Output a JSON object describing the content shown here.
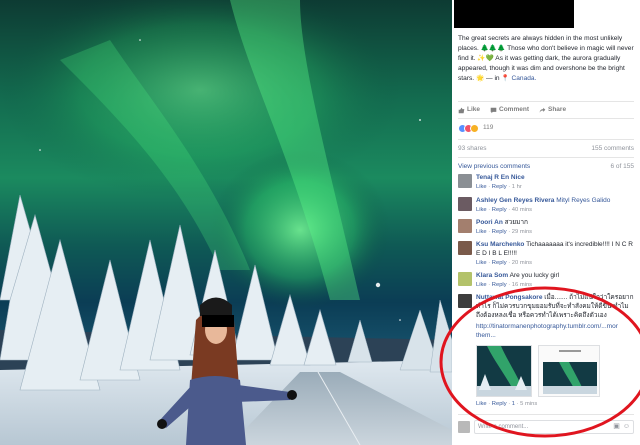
{
  "post": {
    "caption": "The great secrets are always hidden in the most unlikely places. 🌲🌲🌲 Those who don't believe in magic will never find it. ✨💚 As it was getting dark, the aurora gradually appeared, though it was dim and overshone be the bright stars. 🌟",
    "location_prefix": "— in 📍",
    "location": "Canada."
  },
  "actions": {
    "like": "Like",
    "comment": "Comment",
    "share": "Share"
  },
  "reactions": {
    "count": "119"
  },
  "stats": {
    "shares": "93 shares",
    "comments": "155 comments"
  },
  "comments_header": {
    "view_previous": "View previous comments",
    "count": "6 of 155"
  },
  "comments": [
    {
      "name": "Tenaj R En Nice",
      "text": "",
      "meta_like": "Like",
      "meta_reply": "Reply",
      "meta_time": "1 hr",
      "avatar_color": "#8a8f94"
    },
    {
      "name": "Ashley Gen Reyes Rivera",
      "text": "Mityl Reyes Galido",
      "meta_like": "Like",
      "meta_reply": "Reply",
      "meta_time": "40 mins",
      "avatar_color": "#6b5b62"
    },
    {
      "name": "Poori An",
      "text": "สวยมาก",
      "meta_like": "Like",
      "meta_reply": "Reply",
      "meta_time": "29 mins",
      "avatar_color": "#a37f6e"
    },
    {
      "name": "Ksu Marchenko",
      "text": "Tichaaaaaaa it's incredible!!!! I N C R E D I B L E!!!!!",
      "meta_like": "Like",
      "meta_reply": "Reply",
      "meta_time": "20 mins",
      "avatar_color": "#7a5a4a"
    },
    {
      "name": "Klara Som",
      "text": "Are you lucky girl",
      "meta_like": "Like",
      "meta_reply": "Reply",
      "meta_time": "16 mins",
      "avatar_color": "#b3c26a"
    },
    {
      "name": "Nuttawat Pongsakore",
      "text": "เมื่อ....... ถ้าไม่แน่ใจว่าใครอยากทำไร ก็ไม่ควรบวกขุมยอมรับที่จะทำสังคมให้ดีขึ้น ทำไมถึงต้องหลงเชื่อ หรือควรทำได้เพราะคิดถึงตัวเอง",
      "link": "http://tinatormanenphotography.tumblr.com/...mor them...",
      "meta_like": "Like",
      "meta_reply": "Reply",
      "meta_likes": "1",
      "meta_time": "5 mins",
      "avatar_color": "#3d3d3d"
    }
  ],
  "composer": {
    "placeholder": "Write a comment...",
    "camera_icon": "camera-icon",
    "sticker_icon": "sticker-icon"
  },
  "colors": {
    "link": "#365899",
    "muted": "#90949c",
    "highlight": "#e0151f",
    "aurora": "#2fe07a"
  }
}
